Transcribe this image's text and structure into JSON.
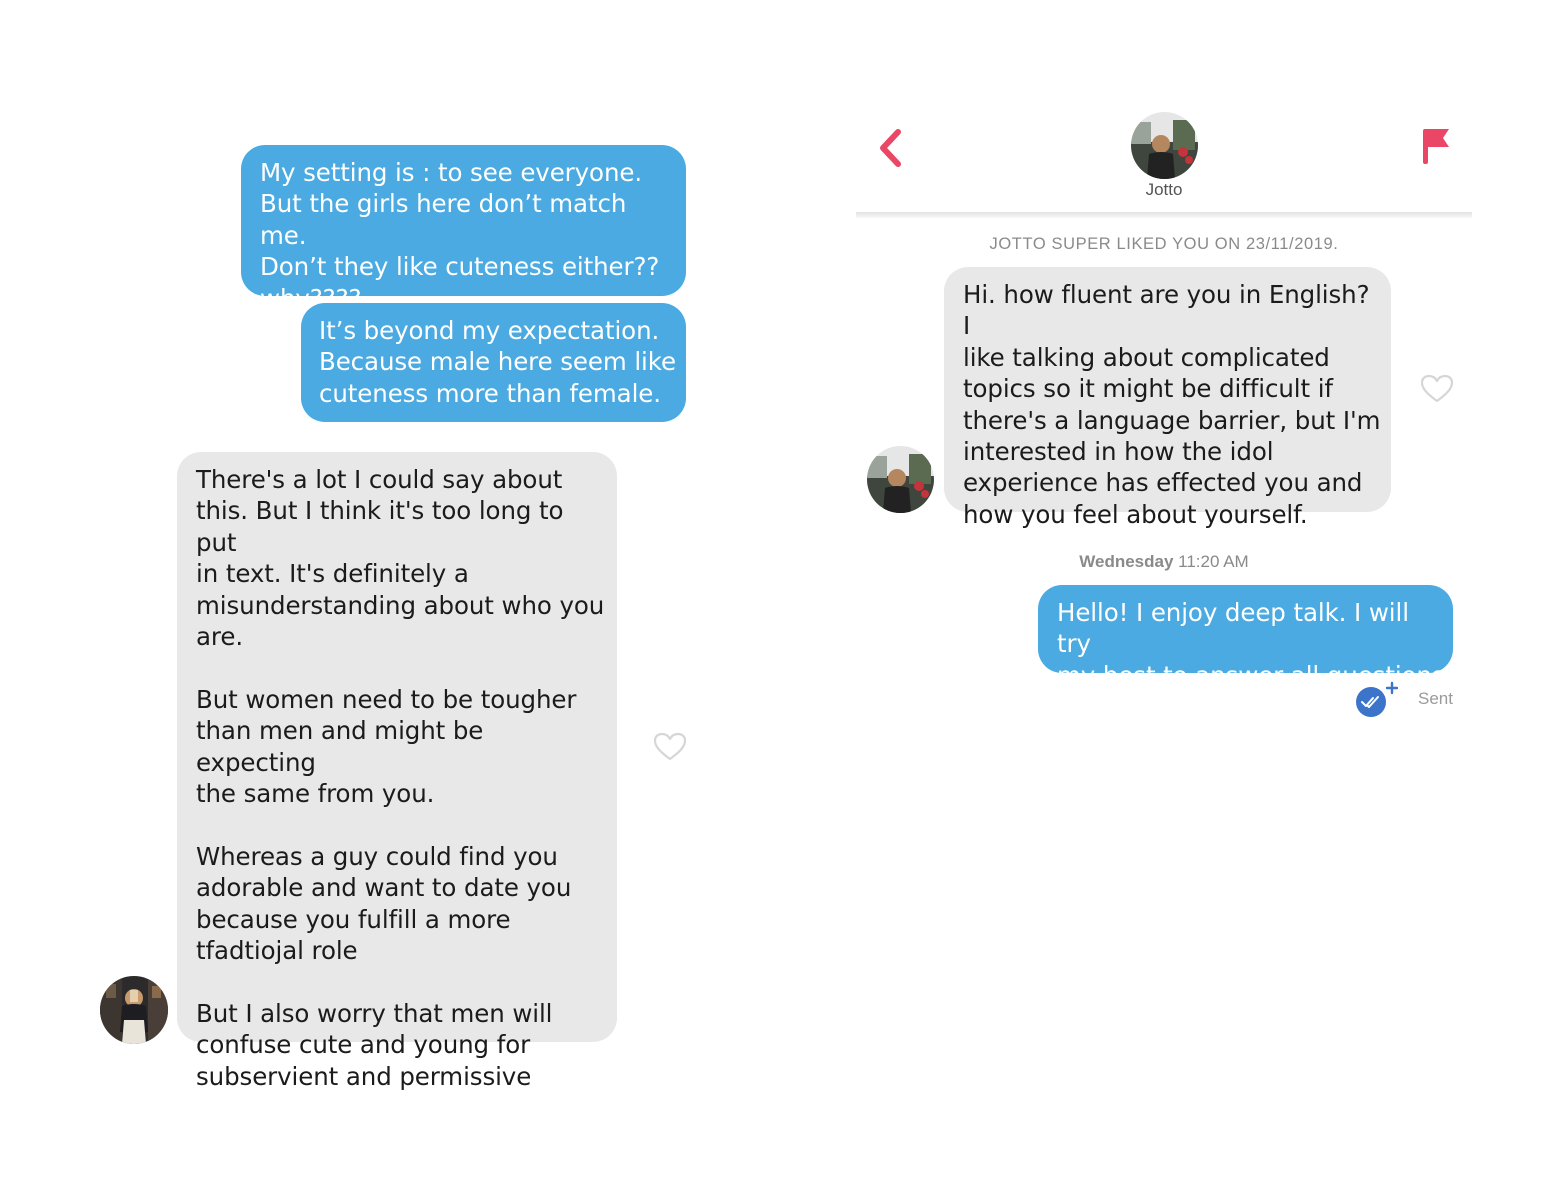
{
  "left_chat": {
    "sent_1": "My setting is : to see everyone.\nBut the girls here don’t match me.\nDon’t they like cuteness either??\nwhy????",
    "sent_2": "It’s beyond my expectation.\nBecause male here seem like\ncuteness more than female.",
    "received_1": "There's a lot I could say about\nthis. But I think it's too long to put\nin text. It's definitely a\nmisunderstanding about who you\nare.\n\nBut women need to be tougher\nthan men and might be expecting\nthe same from you.\n\nWhereas a guy could find you\nadorable and want to date you\nbecause you fulfill a more\ntfadtiojal role\n\nBut I also worry that men will\nconfuse cute and young for\nsubservient and permissive"
  },
  "right_chat": {
    "header": {
      "name": "Jotto"
    },
    "super_like_notice": "JOTTO SUPER LIKED YOU ON 23/11/2019.",
    "received_1": "Hi. how fluent are you in English? I\nlike talking about complicated\ntopics so it might be difficult if\nthere's a language barrier, but I'm\ninterested in how the idol\nexperience has effected you and\nhow you feel about yourself.",
    "timestamp_day": "Wednesday",
    "timestamp_time": "11:20 AM",
    "sent_1": "Hello! I enjoy deep talk. I will try\nmy best to answer all questions",
    "status": "Sent"
  },
  "colors": {
    "sent_bubble": "#4aaae1",
    "received_bubble": "#e8e8e8",
    "accent": "#e94765",
    "read_receipt": "#3b74c9"
  },
  "icons": [
    "back-arrow-icon",
    "flag-icon",
    "heart-icon",
    "read-receipt-icon"
  ]
}
